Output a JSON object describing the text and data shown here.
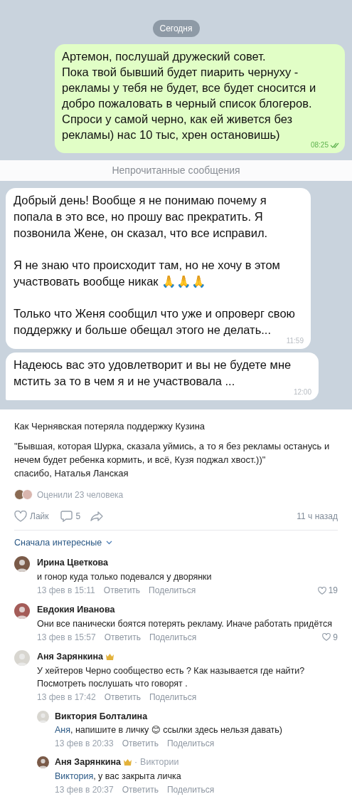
{
  "chat": {
    "date_chip": "Сегодня",
    "messages": [
      {
        "kind": "outgoing",
        "paragraphs": [
          "Артемон, послушай дружеский совет.\nПока твой бывший будет пиарить чернуху - рекламы у тебя не будет, все будет сносится и добро пожаловать в черный список блогеров. Спроси у самой черно, как ей живется без рекламы) нас 10 тыс, хрен остановишь)"
        ],
        "time": "08:25",
        "read": true
      },
      {
        "kind": "divider",
        "label": "Непрочитанные сообщения"
      },
      {
        "kind": "incoming",
        "paragraphs": [
          "Добрый день! Вообще я не понимаю почему я попала в это все, но прошу вас прекратить. Я позвонила Жене, он сказал, что все исправил.",
          "Я не знаю что происходит там, но не хочу в этом участвовать вообще никак 🙏🙏🙏",
          "Только что Женя сообщил что уже и опроверг свою поддержку и больше обещал этого не делать..."
        ],
        "time": "11:59",
        "tail": false
      },
      {
        "kind": "incoming",
        "paragraphs": [
          "Надеюсь вас это удовлетворит и вы не будете мне мстить за то в чем я и не участвовала ..."
        ],
        "time": "12:00",
        "tail": true
      }
    ]
  },
  "post": {
    "title": "Как Чернявская потеряла поддержку Кузина",
    "quote": "\"Бывшая, которая Шурка, сказала уймись, а то я без рекламы останусь и нечем будет ребенка кормить, и всё, Кузя поджал хвост.))\"",
    "signature": "спасибо, Наталья Ланская",
    "rated": "Оценили 23 человека",
    "like_label": "Лайк",
    "comments_count": "5",
    "time": "11 ч назад"
  },
  "comments": {
    "sort": "Сначала интересные",
    "items": [
      {
        "author": "Ирина Цветкова",
        "badge": false,
        "text": "и гонор куда только подевался у дворянки",
        "date": "13 фев в 15:11",
        "reply": "Ответить",
        "share": "Поделиться",
        "likes": "19"
      },
      {
        "author": "Евдокия Иванова",
        "badge": false,
        "text": "Они все панически боятся потерять рекламу. Иначе работать придётся",
        "date": "13 фев в 15:57",
        "reply": "Ответить",
        "share": "Поделиться",
        "likes": "9"
      },
      {
        "author": "Аня Зарянкина",
        "badge": true,
        "text": "У хейтеров Черно сообщество есть ? Как называется где найти? Посмотреть послушать что говорят .",
        "date": "13 фев в 17:42",
        "reply": "Ответить",
        "share": "Поделиться",
        "children": [
          {
            "author": "Виктория Болталина",
            "badge": false,
            "mention": "Аня",
            "text": ", напишите в личку 😊 ссылки здесь нельзя давать)",
            "date": "13 фев в 20:33",
            "reply": "Ответить",
            "share": "Поделиться"
          },
          {
            "author": "Аня Зарянкина",
            "badge": true,
            "separator": "·",
            "addressee": "Виктории",
            "mention": "Виктория",
            "text": ", у вас закрыта личка",
            "date": "13 фев в 20:37",
            "reply": "Ответить",
            "share": "Поделиться"
          }
        ]
      }
    ]
  }
}
